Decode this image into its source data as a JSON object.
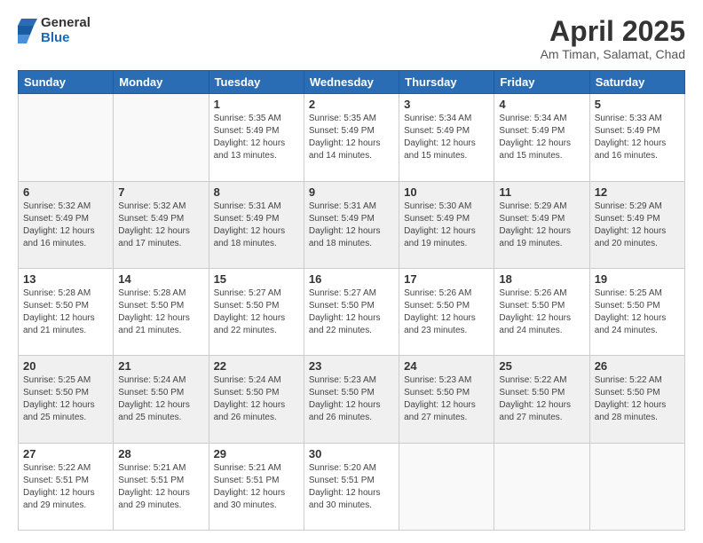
{
  "logo": {
    "general": "General",
    "blue": "Blue"
  },
  "title": "April 2025",
  "subtitle": "Am Timan, Salamat, Chad",
  "days_of_week": [
    "Sunday",
    "Monday",
    "Tuesday",
    "Wednesday",
    "Thursday",
    "Friday",
    "Saturday"
  ],
  "weeks": [
    [
      {
        "num": "",
        "sunrise": "",
        "sunset": "",
        "daylight": ""
      },
      {
        "num": "",
        "sunrise": "",
        "sunset": "",
        "daylight": ""
      },
      {
        "num": "1",
        "sunrise": "Sunrise: 5:35 AM",
        "sunset": "Sunset: 5:49 PM",
        "daylight": "Daylight: 12 hours and 13 minutes."
      },
      {
        "num": "2",
        "sunrise": "Sunrise: 5:35 AM",
        "sunset": "Sunset: 5:49 PM",
        "daylight": "Daylight: 12 hours and 14 minutes."
      },
      {
        "num": "3",
        "sunrise": "Sunrise: 5:34 AM",
        "sunset": "Sunset: 5:49 PM",
        "daylight": "Daylight: 12 hours and 15 minutes."
      },
      {
        "num": "4",
        "sunrise": "Sunrise: 5:34 AM",
        "sunset": "Sunset: 5:49 PM",
        "daylight": "Daylight: 12 hours and 15 minutes."
      },
      {
        "num": "5",
        "sunrise": "Sunrise: 5:33 AM",
        "sunset": "Sunset: 5:49 PM",
        "daylight": "Daylight: 12 hours and 16 minutes."
      }
    ],
    [
      {
        "num": "6",
        "sunrise": "Sunrise: 5:32 AM",
        "sunset": "Sunset: 5:49 PM",
        "daylight": "Daylight: 12 hours and 16 minutes."
      },
      {
        "num": "7",
        "sunrise": "Sunrise: 5:32 AM",
        "sunset": "Sunset: 5:49 PM",
        "daylight": "Daylight: 12 hours and 17 minutes."
      },
      {
        "num": "8",
        "sunrise": "Sunrise: 5:31 AM",
        "sunset": "Sunset: 5:49 PM",
        "daylight": "Daylight: 12 hours and 18 minutes."
      },
      {
        "num": "9",
        "sunrise": "Sunrise: 5:31 AM",
        "sunset": "Sunset: 5:49 PM",
        "daylight": "Daylight: 12 hours and 18 minutes."
      },
      {
        "num": "10",
        "sunrise": "Sunrise: 5:30 AM",
        "sunset": "Sunset: 5:49 PM",
        "daylight": "Daylight: 12 hours and 19 minutes."
      },
      {
        "num": "11",
        "sunrise": "Sunrise: 5:29 AM",
        "sunset": "Sunset: 5:49 PM",
        "daylight": "Daylight: 12 hours and 19 minutes."
      },
      {
        "num": "12",
        "sunrise": "Sunrise: 5:29 AM",
        "sunset": "Sunset: 5:49 PM",
        "daylight": "Daylight: 12 hours and 20 minutes."
      }
    ],
    [
      {
        "num": "13",
        "sunrise": "Sunrise: 5:28 AM",
        "sunset": "Sunset: 5:50 PM",
        "daylight": "Daylight: 12 hours and 21 minutes."
      },
      {
        "num": "14",
        "sunrise": "Sunrise: 5:28 AM",
        "sunset": "Sunset: 5:50 PM",
        "daylight": "Daylight: 12 hours and 21 minutes."
      },
      {
        "num": "15",
        "sunrise": "Sunrise: 5:27 AM",
        "sunset": "Sunset: 5:50 PM",
        "daylight": "Daylight: 12 hours and 22 minutes."
      },
      {
        "num": "16",
        "sunrise": "Sunrise: 5:27 AM",
        "sunset": "Sunset: 5:50 PM",
        "daylight": "Daylight: 12 hours and 22 minutes."
      },
      {
        "num": "17",
        "sunrise": "Sunrise: 5:26 AM",
        "sunset": "Sunset: 5:50 PM",
        "daylight": "Daylight: 12 hours and 23 minutes."
      },
      {
        "num": "18",
        "sunrise": "Sunrise: 5:26 AM",
        "sunset": "Sunset: 5:50 PM",
        "daylight": "Daylight: 12 hours and 24 minutes."
      },
      {
        "num": "19",
        "sunrise": "Sunrise: 5:25 AM",
        "sunset": "Sunset: 5:50 PM",
        "daylight": "Daylight: 12 hours and 24 minutes."
      }
    ],
    [
      {
        "num": "20",
        "sunrise": "Sunrise: 5:25 AM",
        "sunset": "Sunset: 5:50 PM",
        "daylight": "Daylight: 12 hours and 25 minutes."
      },
      {
        "num": "21",
        "sunrise": "Sunrise: 5:24 AM",
        "sunset": "Sunset: 5:50 PM",
        "daylight": "Daylight: 12 hours and 25 minutes."
      },
      {
        "num": "22",
        "sunrise": "Sunrise: 5:24 AM",
        "sunset": "Sunset: 5:50 PM",
        "daylight": "Daylight: 12 hours and 26 minutes."
      },
      {
        "num": "23",
        "sunrise": "Sunrise: 5:23 AM",
        "sunset": "Sunset: 5:50 PM",
        "daylight": "Daylight: 12 hours and 26 minutes."
      },
      {
        "num": "24",
        "sunrise": "Sunrise: 5:23 AM",
        "sunset": "Sunset: 5:50 PM",
        "daylight": "Daylight: 12 hours and 27 minutes."
      },
      {
        "num": "25",
        "sunrise": "Sunrise: 5:22 AM",
        "sunset": "Sunset: 5:50 PM",
        "daylight": "Daylight: 12 hours and 27 minutes."
      },
      {
        "num": "26",
        "sunrise": "Sunrise: 5:22 AM",
        "sunset": "Sunset: 5:50 PM",
        "daylight": "Daylight: 12 hours and 28 minutes."
      }
    ],
    [
      {
        "num": "27",
        "sunrise": "Sunrise: 5:22 AM",
        "sunset": "Sunset: 5:51 PM",
        "daylight": "Daylight: 12 hours and 29 minutes."
      },
      {
        "num": "28",
        "sunrise": "Sunrise: 5:21 AM",
        "sunset": "Sunset: 5:51 PM",
        "daylight": "Daylight: 12 hours and 29 minutes."
      },
      {
        "num": "29",
        "sunrise": "Sunrise: 5:21 AM",
        "sunset": "Sunset: 5:51 PM",
        "daylight": "Daylight: 12 hours and 30 minutes."
      },
      {
        "num": "30",
        "sunrise": "Sunrise: 5:20 AM",
        "sunset": "Sunset: 5:51 PM",
        "daylight": "Daylight: 12 hours and 30 minutes."
      },
      {
        "num": "",
        "sunrise": "",
        "sunset": "",
        "daylight": ""
      },
      {
        "num": "",
        "sunrise": "",
        "sunset": "",
        "daylight": ""
      },
      {
        "num": "",
        "sunrise": "",
        "sunset": "",
        "daylight": ""
      }
    ]
  ]
}
